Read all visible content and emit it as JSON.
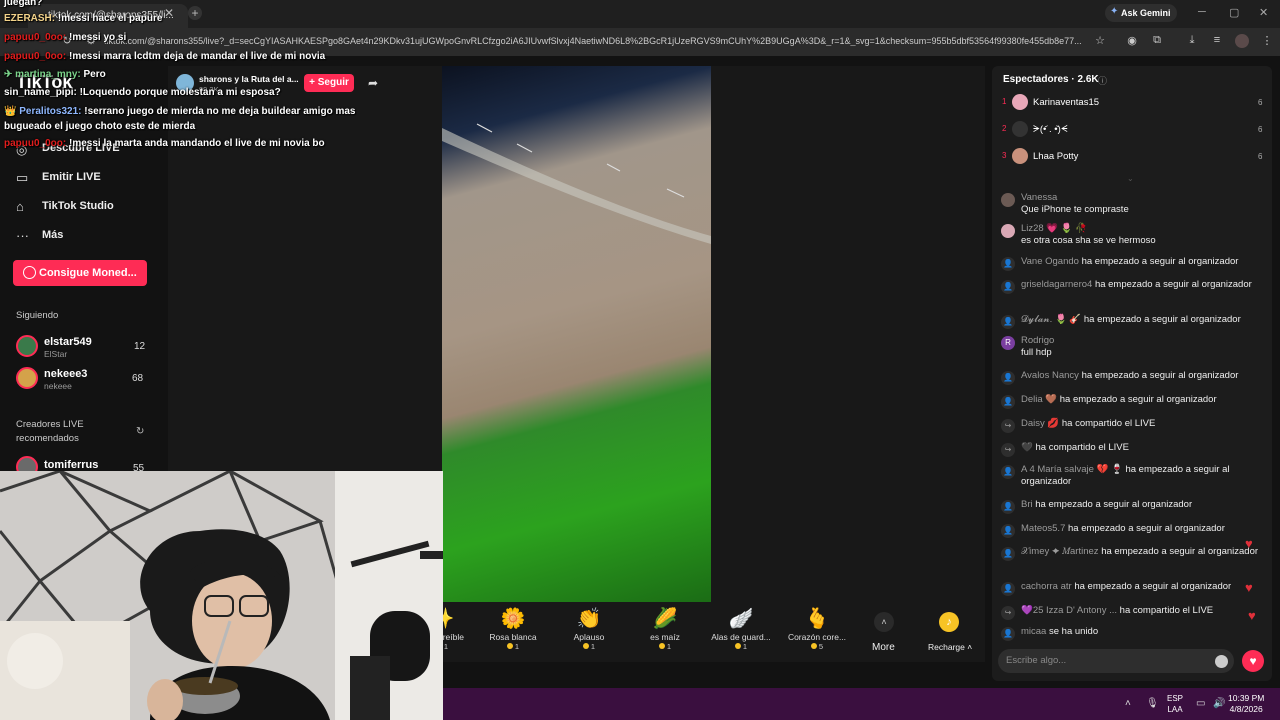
{
  "browser": {
    "tab_title": "tiktok.com/@sharons355/li...",
    "url": "tiktok.com/@sharons355/live?_d=secCgYIASAHKAESPgo8GAet4n29KDkv31ujUGWpoGnvRLCfzgo2iA6JIUvwfSlvxj4NaetiwND6L8%2BGcR1jUzeRGVS9mCUhY%2B9UGgA%3D&_r=1&_svg=1&checksum=955b5dbf53564f99380fe455db8e77...",
    "ask_gemini": "Ask Gemini"
  },
  "sidebar": {
    "logo": "TikTok",
    "nav": [
      {
        "label": "Descubre LIVE",
        "icon": "live-discover-icon"
      },
      {
        "label": "Emitir LIVE",
        "icon": "camera-icon"
      },
      {
        "label": "TikTok Studio",
        "icon": "studio-icon"
      },
      {
        "label": "Más",
        "icon": "more-dots-icon"
      }
    ],
    "coins_button": "Consigue Moned...",
    "following_header": "Siguiendo",
    "following": [
      {
        "name": "elstar549",
        "sub": "ElStar",
        "count": "12"
      },
      {
        "name": "nekeee3",
        "sub": "nekeee",
        "count": "68"
      }
    ],
    "recommended_header": "Creadores LIVE recomendados",
    "recommended": [
      {
        "name": "tomiferrus",
        "count": "55"
      }
    ]
  },
  "stream": {
    "host_name": "sharons y la Ruta del a...",
    "host_views": "99.3K",
    "follow_label": "+ Seguir"
  },
  "gifts": [
    {
      "name": "Increíble",
      "price": "1",
      "icon": "✨"
    },
    {
      "name": "Rosa blanca",
      "price": "1",
      "icon": "🌼"
    },
    {
      "name": "Aplauso",
      "price": "1",
      "icon": "👏"
    },
    {
      "name": "es maíz",
      "price": "1",
      "icon": "🌽"
    },
    {
      "name": "Alas de guard...",
      "price": "1",
      "icon": "🪽"
    },
    {
      "name": "Corazón core...",
      "price": "5",
      "icon": "🫰"
    }
  ],
  "gift_more": "More",
  "recharge": "Recharge",
  "viewers": {
    "title": "Espectadores · 2.6K",
    "top": [
      {
        "rank": "1",
        "name": "Karinaventas15",
        "num": "6",
        "color": "#e8a7b8"
      },
      {
        "rank": "2",
        "name": "ᗒ(•᷄ . •᷅)ᗕ",
        "num": "6",
        "color": "#333333"
      },
      {
        "rank": "3",
        "name": "Lhaa Potty",
        "num": "6",
        "color": "#c9917c"
      }
    ]
  },
  "chat": [
    {
      "user": "Vanessa",
      "text": "Que iPhone te compraste",
      "stacked": true
    },
    {
      "user": "Liz28 💗 🌷 🥀",
      "text": "es otra cosa sha se ve hermoso",
      "stacked": true
    },
    {
      "user": "Vane Ogando",
      "text": "ha empezado a seguir al organizador"
    },
    {
      "user": "griseldagarnero4",
      "text": "ha empezado a seguir al organizador"
    },
    {
      "user": "𝓓𝔂𝓵𝓪𝓷. 🌷 🎸",
      "text": "ha empezado a seguir al organizador"
    },
    {
      "user": "Rodrigo",
      "text": "full hdp",
      "stacked": true
    },
    {
      "user": "Avalos Nancy",
      "text": "ha empezado a seguir al organizador"
    },
    {
      "user": "Delia 🤎",
      "text": "ha empezado a seguir al organizador"
    },
    {
      "user": "Daisy 💋",
      "text": "ha compartido el LIVE"
    },
    {
      "user": "🖤",
      "text": "ha compartido el LIVE"
    },
    {
      "user": "A 4 María salvaje 💔 🍷",
      "text": "ha empezado a seguir al organizador"
    },
    {
      "user": "Bri",
      "text": "ha empezado a seguir al organizador"
    },
    {
      "user": "Mateos5.7",
      "text": "ha empezado a seguir al organizador"
    },
    {
      "user": "𝒳imey ✦ 𝑀artinez",
      "text": "ha empezado a seguir al organizador"
    },
    {
      "user": "cachorra atr",
      "text": "ha empezado a seguir al organizador"
    },
    {
      "user": "💜25 Izza D' Antony ...",
      "text": "ha compartido el LIVE"
    },
    {
      "user": "micaa",
      "text": "se ha unido"
    }
  ],
  "chat_input_placeholder": "Escribe algo...",
  "overlay_chat": [
    {
      "user": "juegan?",
      "msg": "",
      "red": false
    },
    {
      "user": "EZERASH:",
      "msg": "!messi hace el papure",
      "red": false
    },
    {
      "user": "papuu0_0oo:",
      "msg": "!messi yo si",
      "red": true
    },
    {
      "user": "papuu0_0oo:",
      "msg": "!messi marra lcdtm deja de mandar el live de mi novia",
      "red": true
    },
    {
      "user": "✈ martina_mny:",
      "msg": "Pero",
      "red": false
    },
    {
      "user": "sin_name_pipi:",
      "msg": "!Loquendo porque molestan a mi esposa?",
      "red": false
    },
    {
      "user": "👑 Peralitos321:",
      "msg": "!serrano juego de mierda no me deja buildear amigo mas",
      "red": false
    },
    {
      "user": "",
      "msg": "bugueado el juego choto este de mierda",
      "red": false
    },
    {
      "user": "papuu0_0oo:",
      "msg": "!messi la marta anda mandando el live de mi novia bo",
      "red": true
    }
  ],
  "taskbar": {
    "lang_top": "ESP",
    "lang_bottom": "LAA",
    "time": "10:39 PM",
    "date": "4/8/2026"
  }
}
